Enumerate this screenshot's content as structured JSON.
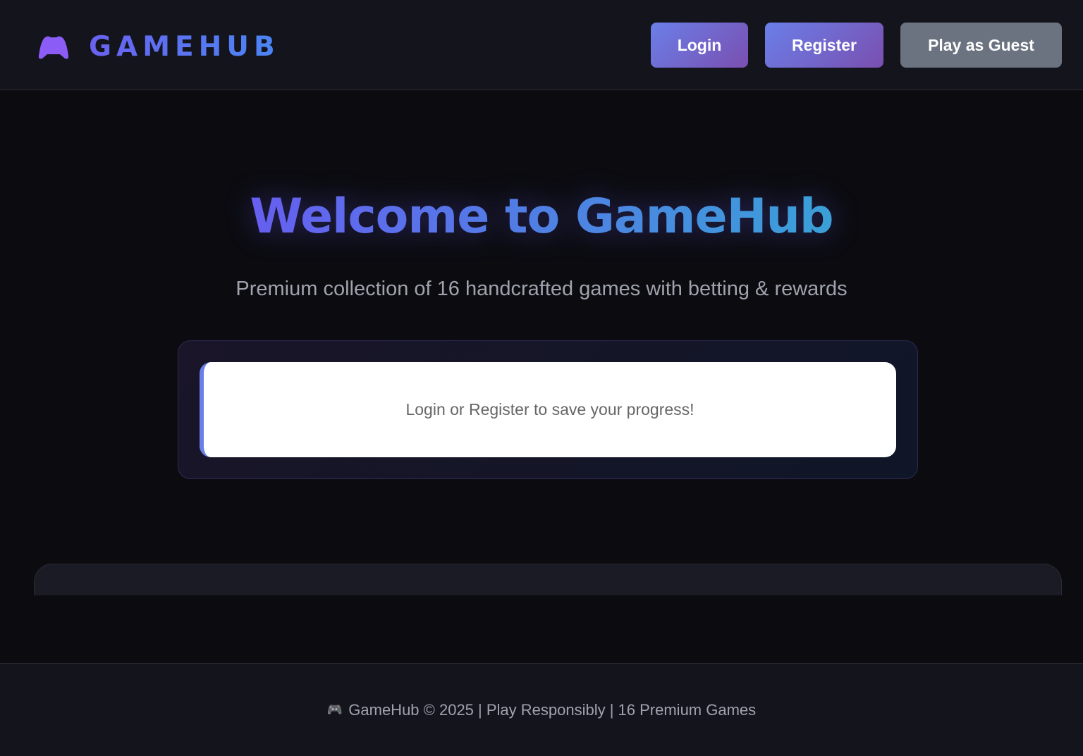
{
  "header": {
    "brand": "GAMEHUB",
    "logo_icon": "gamepad-icon",
    "login_label": "Login",
    "register_label": "Register",
    "guest_label": "Play as Guest"
  },
  "hero": {
    "title": "Welcome to GameHub",
    "subtitle": "Premium collection of 16 handcrafted games with betting & rewards"
  },
  "notice": {
    "message": "Login or Register to save your progress!"
  },
  "footer": {
    "icon": "🎮",
    "text": "GameHub © 2025 | Play Responsibly | 16 Premium Games"
  },
  "colors": {
    "accent_start": "#667eea",
    "accent_end": "#764ba2",
    "guest": "#6b7280"
  }
}
